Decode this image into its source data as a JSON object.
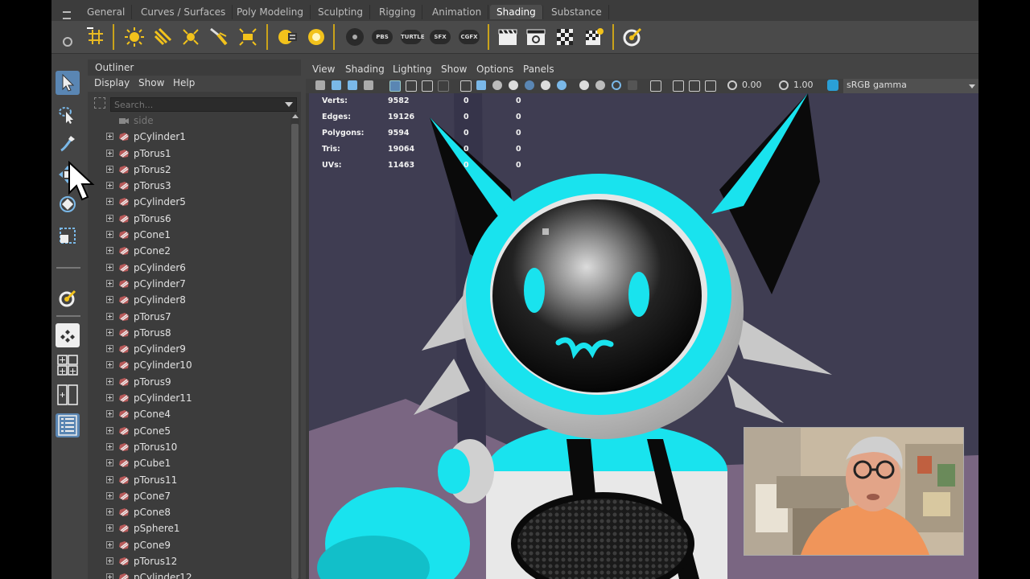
{
  "shelf_tabs": [
    "General",
    "Curves / Surfaces",
    "Poly Modeling",
    "Sculpting",
    "Rigging",
    "Animation",
    "Shading",
    "Substance"
  ],
  "active_tab_index": 6,
  "shelf": {
    "pill_labels": [
      "PBS",
      "TURTLE",
      "SFX",
      "CGFX"
    ]
  },
  "outliner": {
    "title": "Outliner",
    "menu": [
      "Display",
      "Show",
      "Help"
    ],
    "search_placeholder": "Search...",
    "items": [
      {
        "name": "side",
        "type": "camera"
      },
      {
        "name": "pCylinder1",
        "type": "mesh"
      },
      {
        "name": "pTorus1",
        "type": "mesh"
      },
      {
        "name": "pTorus2",
        "type": "mesh"
      },
      {
        "name": "pTorus3",
        "type": "mesh"
      },
      {
        "name": "pCylinder5",
        "type": "mesh"
      },
      {
        "name": "pTorus6",
        "type": "mesh"
      },
      {
        "name": "pCone1",
        "type": "mesh"
      },
      {
        "name": "pCone2",
        "type": "mesh"
      },
      {
        "name": "pCylinder6",
        "type": "mesh"
      },
      {
        "name": "pCylinder7",
        "type": "mesh"
      },
      {
        "name": "pCylinder8",
        "type": "mesh"
      },
      {
        "name": "pTorus7",
        "type": "mesh"
      },
      {
        "name": "pTorus8",
        "type": "mesh"
      },
      {
        "name": "pCylinder9",
        "type": "mesh"
      },
      {
        "name": "pCylinder10",
        "type": "mesh"
      },
      {
        "name": "pTorus9",
        "type": "mesh"
      },
      {
        "name": "pCylinder11",
        "type": "mesh"
      },
      {
        "name": "pCone4",
        "type": "mesh"
      },
      {
        "name": "pCone5",
        "type": "mesh"
      },
      {
        "name": "pTorus10",
        "type": "mesh"
      },
      {
        "name": "pCube1",
        "type": "mesh"
      },
      {
        "name": "pTorus11",
        "type": "mesh"
      },
      {
        "name": "pCone7",
        "type": "mesh"
      },
      {
        "name": "pCone8",
        "type": "mesh"
      },
      {
        "name": "pSphere1",
        "type": "mesh"
      },
      {
        "name": "pCone9",
        "type": "mesh"
      },
      {
        "name": "pTorus12",
        "type": "mesh"
      },
      {
        "name": "pCylinder12",
        "type": "mesh"
      }
    ]
  },
  "viewport": {
    "menu": [
      "View",
      "Shading",
      "Lighting",
      "Show",
      "Options",
      "Panels"
    ],
    "exposure": "0.00",
    "gamma": "1.00",
    "color_space": "sRGB gamma",
    "hud": [
      {
        "label": "Verts:",
        "v1": "9582",
        "v2": "0",
        "v3": "0"
      },
      {
        "label": "Edges:",
        "v1": "19126",
        "v2": "0",
        "v3": "0"
      },
      {
        "label": "Polygons:",
        "v1": "9594",
        "v2": "0",
        "v3": "0"
      },
      {
        "label": "Tris:",
        "v1": "19064",
        "v2": "0",
        "v3": "0"
      },
      {
        "label": "UVs:",
        "v1": "11463",
        "v2": "0",
        "v3": "0"
      }
    ]
  },
  "colors": {
    "accent_selected": "#5a86b3",
    "shelf_separator": "#caa31a",
    "robot_cyan": "#19e3ee",
    "viewport_background": "#3f3d52"
  }
}
